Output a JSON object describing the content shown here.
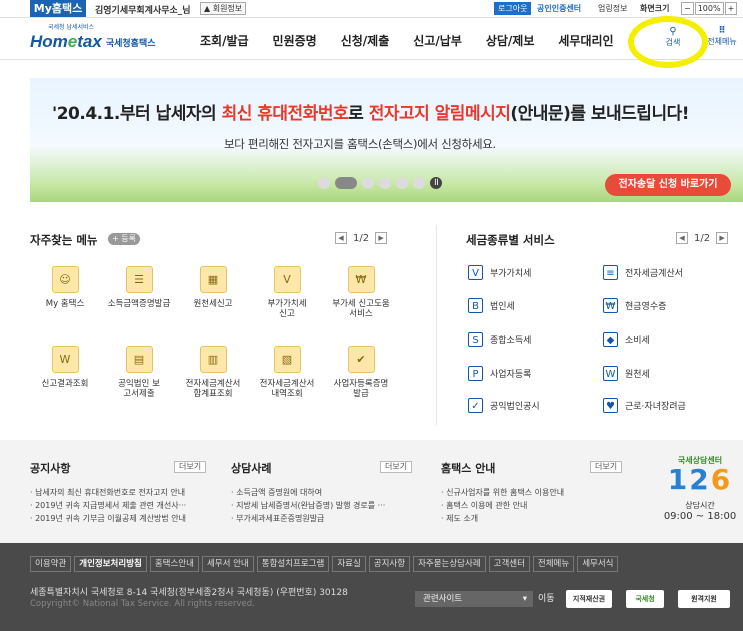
{
  "topbar": {
    "my_home": "My홈택스",
    "org": "김영기세무회계사무소_님",
    "member_info": "회원정보",
    "logout": "로그아웃",
    "cert_center": "공인인증센터",
    "links": [
      "업링정보",
      "화면크기"
    ],
    "zoom": [
      "−",
      "100%",
      "+"
    ]
  },
  "header": {
    "logo_small": "국세청 남세서비스",
    "logo_main_a": "Hom",
    "logo_main_e": "e",
    "logo_main_b": "tax",
    "logo_sub": "국세청홈택스",
    "nav": [
      "조회/발급",
      "민원증명",
      "신청/제출",
      "신고/납부",
      "상담/제보",
      "세무대리인"
    ],
    "search_label": "검색",
    "allmenu_label": "전체메뉴",
    "highlight_color": "#f4ee00"
  },
  "banner": {
    "main_a": "'20.4.1.부터 납세자의 ",
    "main_b": "최신 휴대전화번호",
    "main_c": "로 ",
    "main_d": "전자고지 알림메시지",
    "main_e": "(안내문)를 보내드립니다!",
    "sub": "보다 편리해진 전자고지를 홈택스(손택스)에서 신청하세요.",
    "button": "전자송달 신청 바로가기"
  },
  "fav": {
    "title": "자주찾는 메뉴",
    "add": "+ 등록",
    "page": "1/2",
    "items": [
      {
        "label": "My 홈택스",
        "icon": "person-icon"
      },
      {
        "label": "소득금액증명발급",
        "icon": "document-icon"
      },
      {
        "label": "원천세신고",
        "icon": "calendar-icon"
      },
      {
        "label": "부가가치세 신고",
        "icon": "vat-icon"
      },
      {
        "label": "부가세 신고도움 서비스",
        "icon": "won-icon"
      },
      {
        "label": "신고결과조회",
        "icon": "search-doc-icon"
      },
      {
        "label": "공익법인 보고서제출",
        "icon": "building-icon"
      },
      {
        "label": "전자세금계산서 합계표조회",
        "icon": "table-icon"
      },
      {
        "label": "전자세금계산서 내역조회",
        "icon": "receipt-icon"
      },
      {
        "label": "사업자등록증명 발급",
        "icon": "card-icon"
      }
    ]
  },
  "tax": {
    "title": "세금종류별 서비스",
    "page": "1/2",
    "items": [
      {
        "label": "부가가치세",
        "icon": "vat-icon",
        "glyph": "V"
      },
      {
        "label": "전자세금계산서",
        "icon": "invoice-icon",
        "glyph": "≡"
      },
      {
        "label": "법인세",
        "icon": "corp-icon",
        "glyph": "B"
      },
      {
        "label": "현금영수증",
        "icon": "cash-receipt-icon",
        "glyph": "₩"
      },
      {
        "label": "종합소득세",
        "icon": "income-icon",
        "glyph": "S"
      },
      {
        "label": "소비세",
        "icon": "diamond-icon",
        "glyph": "◆"
      },
      {
        "label": "사업자등록",
        "icon": "person-icon",
        "glyph": "P"
      },
      {
        "label": "원천세",
        "icon": "withholding-icon",
        "glyph": "W"
      },
      {
        "label": "공익법인공시",
        "icon": "check-doc-icon",
        "glyph": "✓"
      },
      {
        "label": "근로·자녀장려금",
        "icon": "heart-icon",
        "glyph": "♥"
      }
    ]
  },
  "notices": {
    "more": "더보기",
    "columns": [
      {
        "title": "공지사항",
        "items": [
          "납세자의 최신 휴대전화번호로 전자고지 안내",
          "2019년 귀속 지급명세서 제출 관련 개선사···",
          "2019년 귀속 기부금 이월공제 계산방법 안내"
        ]
      },
      {
        "title": "상담사례",
        "items": [
          "소득금액 증명원에 대하여",
          "지방세 납세증명서(완납증명) 발행 경로를 ···",
          "부가세과세표준증명원발급"
        ]
      },
      {
        "title": "홈택스 안내",
        "items": [
          "신규사업자를 위한 홈택스 이용안내",
          "홈택스 이용에 관한 안내",
          "제도 소개"
        ]
      }
    ],
    "center": {
      "top": "국세상담센터",
      "num_a": "12",
      "num_b": "6",
      "time_label": "상담시간",
      "hours": "09:00 ~ 18:00"
    }
  },
  "footer": {
    "links": [
      "이용약관",
      "개인정보처리방침",
      "홈택스안내",
      "세무서 안내",
      "통합설치프로그램",
      "자료실",
      "공지사항",
      "자주묻는상담사례",
      "고객센터",
      "전체메뉴",
      "세무서식"
    ],
    "address": "세종특별자치시 국세청로 8-14 국세청(정부세종2청사 국세청동) (우편번호) 30128",
    "copyright": "Copyright© National Tax Service. All rights reserved.",
    "related": "관련사이트",
    "go": "이동",
    "badges": [
      "지적재산권",
      "국세청",
      "원격지원"
    ]
  }
}
